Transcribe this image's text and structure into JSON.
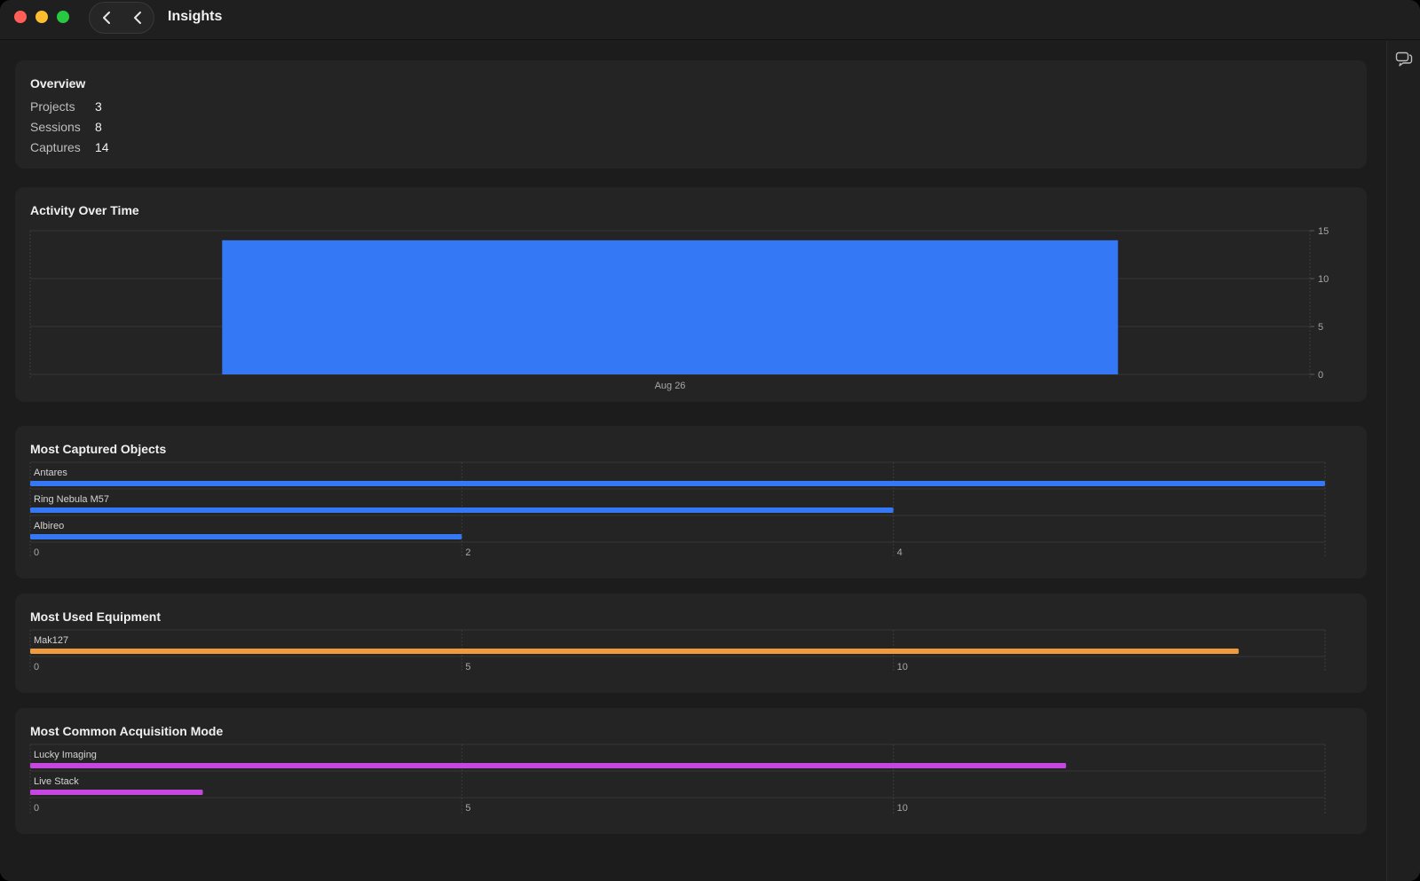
{
  "window": {
    "title": "Insights"
  },
  "overview": {
    "title": "Overview",
    "rows": [
      {
        "label": "Projects",
        "value": "3"
      },
      {
        "label": "Sessions",
        "value": "8"
      },
      {
        "label": "Captures",
        "value": "14"
      }
    ]
  },
  "icons": {
    "back": "chevron-left-icon",
    "forward": "chevron-left-icon",
    "inspector": "speech-bubbles-icon"
  },
  "colors": {
    "blue": "#3478f6",
    "orange": "#f09a3e",
    "magenta": "#c646e0"
  },
  "chart_data": [
    {
      "type": "bar",
      "title": "Activity Over Time",
      "categories": [
        "Aug 26"
      ],
      "values": [
        14
      ],
      "ylim": [
        0,
        15
      ],
      "yticks": [
        0,
        5,
        10,
        15
      ],
      "grid": true,
      "color": "#3478f6"
    },
    {
      "type": "bar",
      "orientation": "horizontal",
      "title": "Most Captured Objects",
      "categories": [
        "Antares",
        "Ring Nebula M57",
        "Albireo"
      ],
      "values": [
        6,
        4,
        2
      ],
      "xlim": [
        0,
        6
      ],
      "xticks": [
        0,
        2,
        4
      ],
      "grid": true,
      "color": "#3478f6"
    },
    {
      "type": "bar",
      "orientation": "horizontal",
      "title": "Most Used Equipment",
      "categories": [
        "Mak127"
      ],
      "values": [
        14
      ],
      "xlim": [
        0,
        15
      ],
      "xticks": [
        0,
        5,
        10
      ],
      "grid": true,
      "color": "#f09a3e"
    },
    {
      "type": "bar",
      "orientation": "horizontal",
      "title": "Most Common Acquisition Mode",
      "categories": [
        "Lucky Imaging",
        "Live Stack"
      ],
      "values": [
        12,
        2
      ],
      "xlim": [
        0,
        15
      ],
      "xticks": [
        0,
        5,
        10
      ],
      "grid": true,
      "color": "#c646e0"
    }
  ]
}
